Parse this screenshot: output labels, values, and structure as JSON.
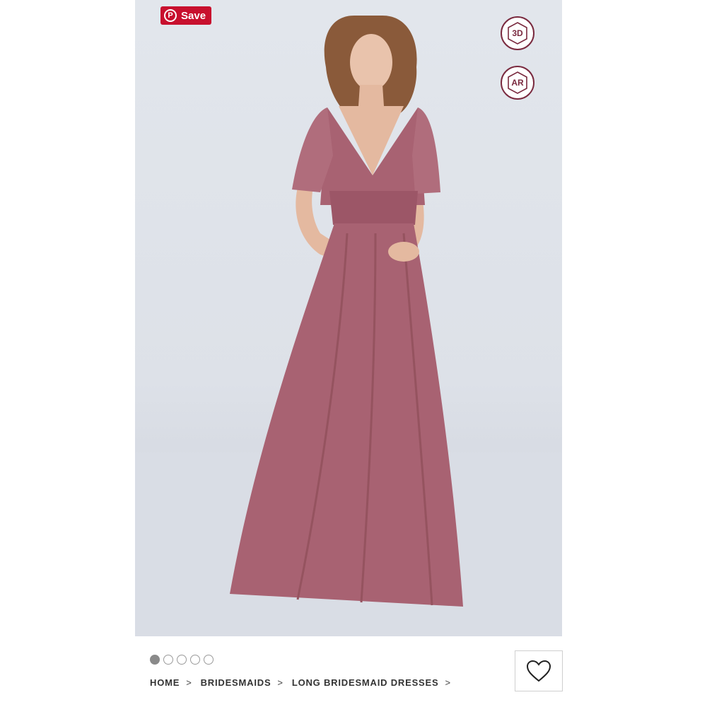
{
  "product_image": {
    "background": "#dfe3e9",
    "dress_color": "#a86272"
  },
  "save_button": {
    "label": "Save",
    "color": "#c8102e",
    "icon": "pinterest-icon"
  },
  "view_3d_button": {
    "label": "3D",
    "icon": "3d-view-icon"
  },
  "ar_button": {
    "label": "AR",
    "icon": "ar-view-icon"
  },
  "carousel": {
    "count": 5,
    "active_index": 0
  },
  "breadcrumb": {
    "items": [
      "HOME",
      "BRIDESMAIDS",
      "LONG BRIDESMAID DRESSES"
    ],
    "separator": ">"
  },
  "favorite_button": {
    "icon": "heart-icon"
  }
}
